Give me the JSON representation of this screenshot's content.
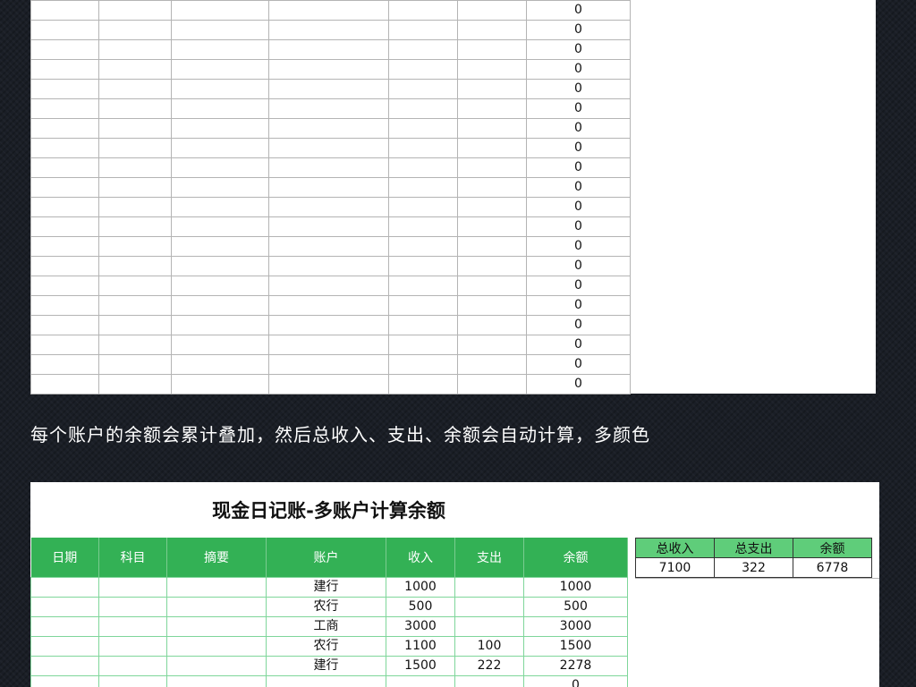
{
  "top_sheet": {
    "balance_values": [
      "0",
      "0",
      "0",
      "0",
      "0",
      "0",
      "0",
      "0",
      "0",
      "0",
      "0",
      "0",
      "0",
      "0",
      "0",
      "0",
      "0",
      "0",
      "0",
      "0"
    ]
  },
  "caption": "每个账户的余额会累计叠加，然后总收入、支出、余额会自动计算，多颜色",
  "ledger": {
    "title": "现金日记账-多账户计算余额",
    "headers": [
      "日期",
      "科目",
      "摘要",
      "账户",
      "收入",
      "支出",
      "余额"
    ],
    "rows": [
      [
        "",
        "",
        "",
        "建行",
        "1000",
        "",
        "1000"
      ],
      [
        "",
        "",
        "",
        "农行",
        "500",
        "",
        "500"
      ],
      [
        "",
        "",
        "",
        "工商",
        "3000",
        "",
        "3000"
      ],
      [
        "",
        "",
        "",
        "农行",
        "1100",
        "100",
        "1500"
      ],
      [
        "",
        "",
        "",
        "建行",
        "1500",
        "222",
        "2278"
      ],
      [
        "",
        "",
        "",
        "",
        "",
        "",
        "0"
      ]
    ],
    "summary": {
      "headers": [
        "总收入",
        "总支出",
        "余额"
      ],
      "values": [
        "7100",
        "322",
        "6778"
      ]
    }
  },
  "colors": {
    "header_green": "#33b155",
    "summary_header_green": "#5fcd7a",
    "background": "#1a1e26"
  }
}
